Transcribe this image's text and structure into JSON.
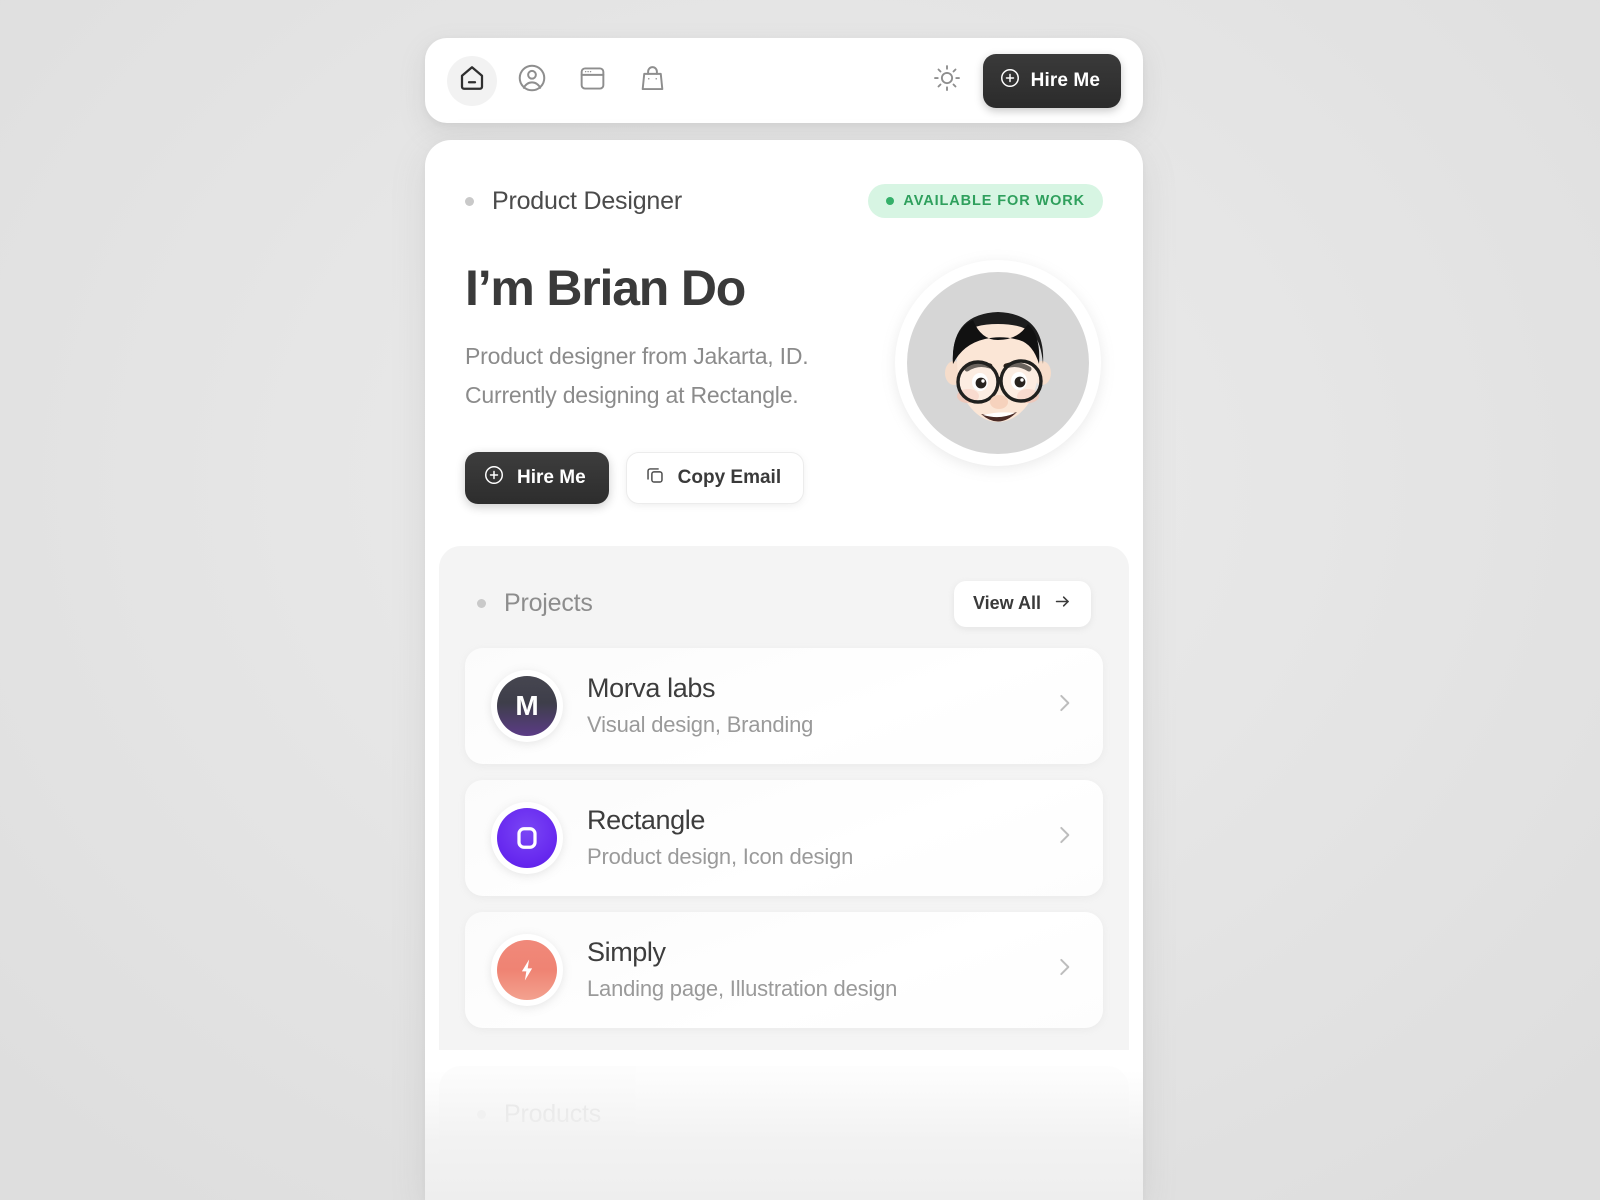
{
  "navbar": {
    "items": [
      {
        "icon": "home-icon",
        "name": "home",
        "active": true
      },
      {
        "icon": "user-circle-icon",
        "name": "about",
        "active": false
      },
      {
        "icon": "browser-window-icon",
        "name": "work",
        "active": false
      },
      {
        "icon": "shopping-bag-icon",
        "name": "shop",
        "active": false
      }
    ],
    "theme_toggle_icon": "sun-icon",
    "hire_label": "Hire Me",
    "hire_icon": "plus-circle-icon"
  },
  "hero": {
    "eyebrow": "Product Designer",
    "badge": "AVAILABLE FOR WORK",
    "title": "I’m Brian Do",
    "subtitle_line1": "Product designer from Jakarta, ID.",
    "subtitle_line2": "Currently designing at Rectangle.",
    "hire_label": "Hire Me",
    "copy_email_label": "Copy Email",
    "avatar_alt": "memoji-avatar"
  },
  "projects": {
    "title": "Projects",
    "view_all_label": "View All",
    "items": [
      {
        "name": "Morva labs",
        "tags": "Visual design, Branding",
        "logo_text": "M",
        "logo_style": "logo-morva",
        "logo_color": "#4a3c72"
      },
      {
        "name": "Rectangle",
        "tags": "Product design, Icon design",
        "logo_text": "",
        "logo_style": "logo-rectangle",
        "logo_color": "#6a2df0"
      },
      {
        "name": "Simply",
        "tags": "Landing page, Illustration design",
        "logo_text": "",
        "logo_style": "logo-simply",
        "logo_color": "#ef8373"
      }
    ]
  },
  "products": {
    "title": "Products"
  },
  "colors": {
    "accent_dark": "#2d2d2d",
    "badge_bg": "#d7f5e3",
    "badge_text": "#2fa05d",
    "panel_bg": "#f4f4f4",
    "card_bg": "#ffffff",
    "page_bg": "#e6e6e6"
  }
}
